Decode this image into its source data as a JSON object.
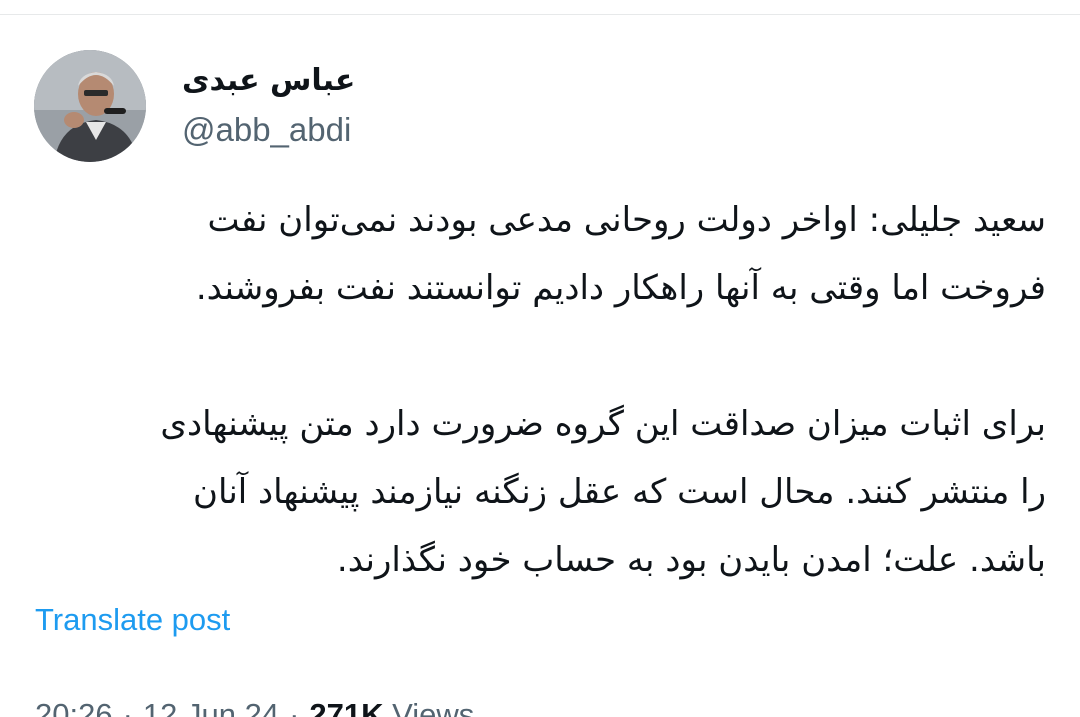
{
  "author": {
    "display_name": "عباس عبدی",
    "handle": "@abb_abdi",
    "avatar_icon": "profile-photo-avatar"
  },
  "post": {
    "paragraphs": [
      {
        "lines": [
          "سعید جلیلی: اواخر دولت روحانی مدعی بودند نمی‌توان نفت",
          "فروخت اما وقتی به آنها راهکار دادیم توانستند نفت بفروشند."
        ]
      },
      {
        "lines": [
          "برای اثبات میزان صداقت این گروه ضرورت دارد متن پیشنهادی",
          "را منتشر کنند. محال است که عقل زنگنه نیازمند پیشنهاد آنان",
          "باشد. علت؛ امدن بایدن بود به حساب خود نگذارند."
        ]
      }
    ],
    "translate_label": "Translate post"
  },
  "meta": {
    "time": "20:26",
    "date": "12 Jun 24",
    "separator": "·",
    "views_count": "271K",
    "views_label": "Views"
  },
  "colors": {
    "text_primary": "#0f1419",
    "text_secondary": "#536471",
    "link": "#1d9bf0",
    "divider": "#e7e9ea"
  }
}
